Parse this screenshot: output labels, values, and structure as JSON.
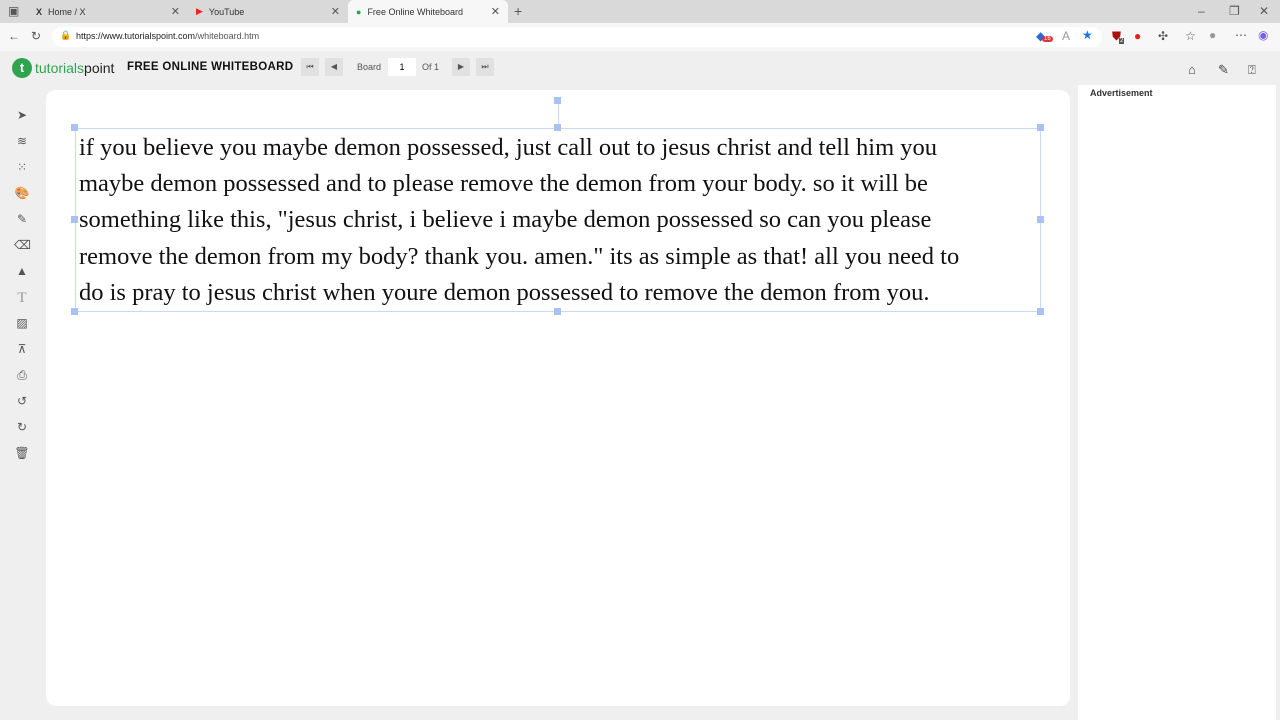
{
  "browser": {
    "tabs": [
      {
        "title": "Home / X"
      },
      {
        "title": "YouTube"
      },
      {
        "title": "Free Online Whiteboard"
      }
    ],
    "url_host": "https://www.tutorialspoint.com",
    "url_path": "/whiteboard.htm",
    "badges": {
      "ext1": "16",
      "ext2": "2"
    }
  },
  "header": {
    "logo_prefix": "tutorials",
    "logo_suffix": "point",
    "title": "FREE ONLINE WHITEBOARD",
    "board_label": "Board",
    "page": "1",
    "of_label": "Of 1"
  },
  "ad": {
    "label": "Advertisement"
  },
  "board": {
    "lines": [
      "if you believe you maybe demon possessed, just call out to jesus christ and tell him you",
      "maybe demon possessed and to please remove the demon from your body. so it will be",
      "something like this, \"jesus christ, i believe i maybe demon possessed so can you please",
      "remove the demon from my body? thank you. amen.\" its as simple as that! all you need to",
      "do is pray to jesus christ when youre demon possessed to remove the demon from you."
    ]
  }
}
